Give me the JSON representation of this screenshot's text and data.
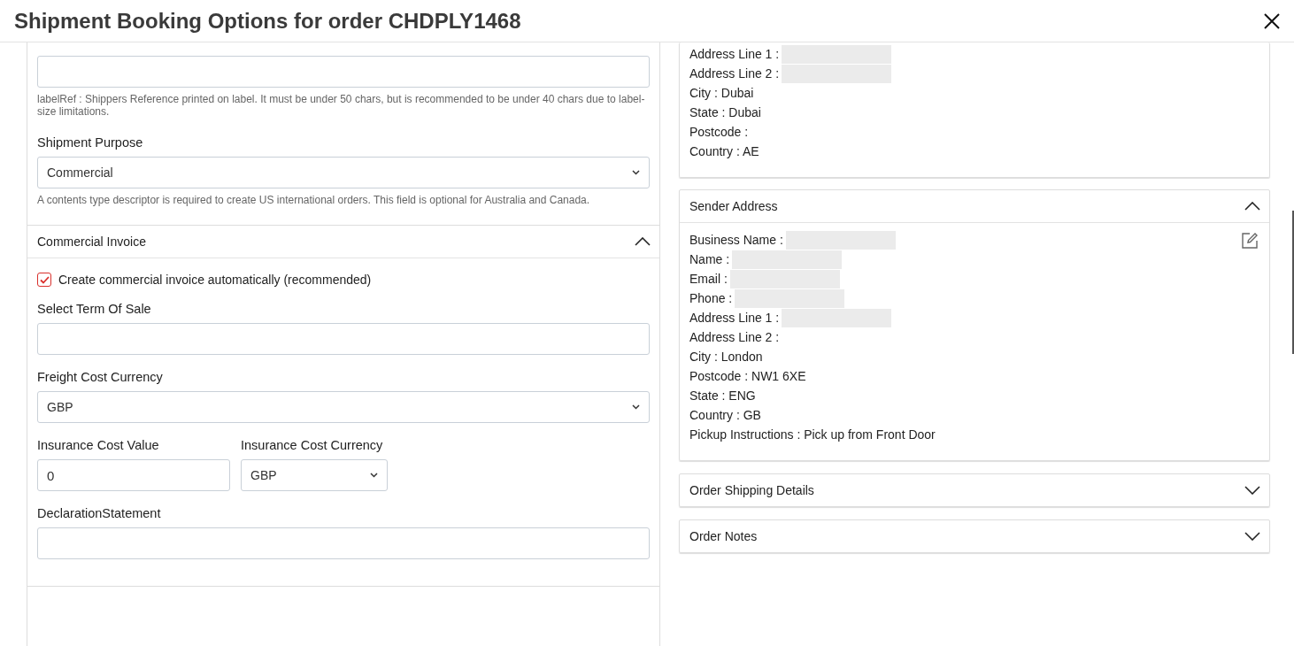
{
  "dialog": {
    "title": "Shipment Booking Options for order CHDPLY1468"
  },
  "booking_form": {
    "label_reference_field": {
      "hint": "labelRef : Shippers Reference printed on label. It must be under 50 chars, but is recommended to be under 40 chars due to label-size limitations."
    },
    "shipment_purpose": {
      "label": "Shipment Purpose",
      "value": "Commercial",
      "hint": "A contents type descriptor is required to create US international orders. This field is optional for Australia and Canada."
    }
  },
  "commercial_invoice": {
    "title": "Commercial Invoice",
    "expanded": true,
    "auto_create": {
      "label": "Create commercial invoice automatically (recommended)",
      "checked": true
    },
    "fields": [
      {
        "kind": "input",
        "label": "Select Term Of Sale"
      },
      {
        "kind": "select",
        "label": "Freight Cost Currency",
        "value": "GBP"
      },
      {
        "kind": "pair",
        "fields": [
          {
            "kind": "input",
            "label": "Insurance Cost Value",
            "value": "0"
          },
          {
            "kind": "select",
            "label": "Insurance Cost Currency",
            "value": "GBP"
          }
        ]
      },
      {
        "kind": "input",
        "label": "DeclarationStatement"
      }
    ]
  },
  "receiver_address": {
    "lines": [
      {
        "text": "Address Line 1 :",
        "redacted": true
      },
      {
        "text": "Address Line 2 :",
        "redacted": true
      },
      {
        "text": "City : Dubai",
        "redacted": false
      },
      {
        "text": "State : Dubai",
        "redacted": false
      },
      {
        "text": "Postcode :",
        "redacted": false
      },
      {
        "text": "Country : AE",
        "redacted": false
      }
    ]
  },
  "sender_address": {
    "title": "Sender Address",
    "expanded": true,
    "lines": [
      {
        "text": "Business Name :",
        "redacted": true
      },
      {
        "text": "Name :",
        "redacted": true
      },
      {
        "text": "Email :",
        "redacted": true
      },
      {
        "text": "Phone :",
        "redacted": true
      },
      {
        "text": "Address Line 1 :",
        "redacted": true
      },
      {
        "text": "Address Line 2 :",
        "redacted": false
      },
      {
        "text": "City : London",
        "redacted": false
      },
      {
        "text": "Postcode : NW1 6XE",
        "redacted": false
      },
      {
        "text": "State : ENG",
        "redacted": false
      },
      {
        "text": "Country : GB",
        "redacted": false
      },
      {
        "text": "Pickup Instructions : Pick up from Front Door",
        "redacted": false
      }
    ]
  },
  "sections": [
    {
      "title": "Order Shipping Details",
      "expanded": false
    },
    {
      "title": "Order Notes",
      "expanded": false
    }
  ]
}
